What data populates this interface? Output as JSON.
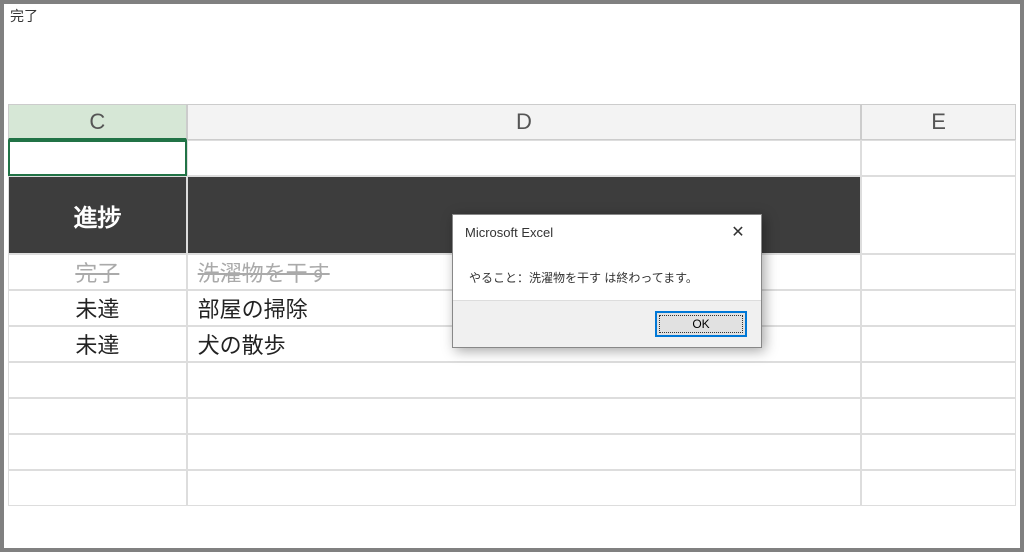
{
  "formula_bar": "完了",
  "columns": {
    "c": "C",
    "d": "D",
    "e": "E"
  },
  "header": {
    "c": "進捗",
    "d": ""
  },
  "rows": [
    {
      "c": "完了",
      "d": "洗濯物を干す",
      "strike": true
    },
    {
      "c": "未達",
      "d": "部屋の掃除",
      "strike": false
    },
    {
      "c": "未達",
      "d": "犬の散歩",
      "strike": false
    }
  ],
  "dialog": {
    "title": "Microsoft Excel",
    "close": "✕",
    "message": "やること：洗濯物を干す は終わってます。",
    "ok": "OK"
  }
}
